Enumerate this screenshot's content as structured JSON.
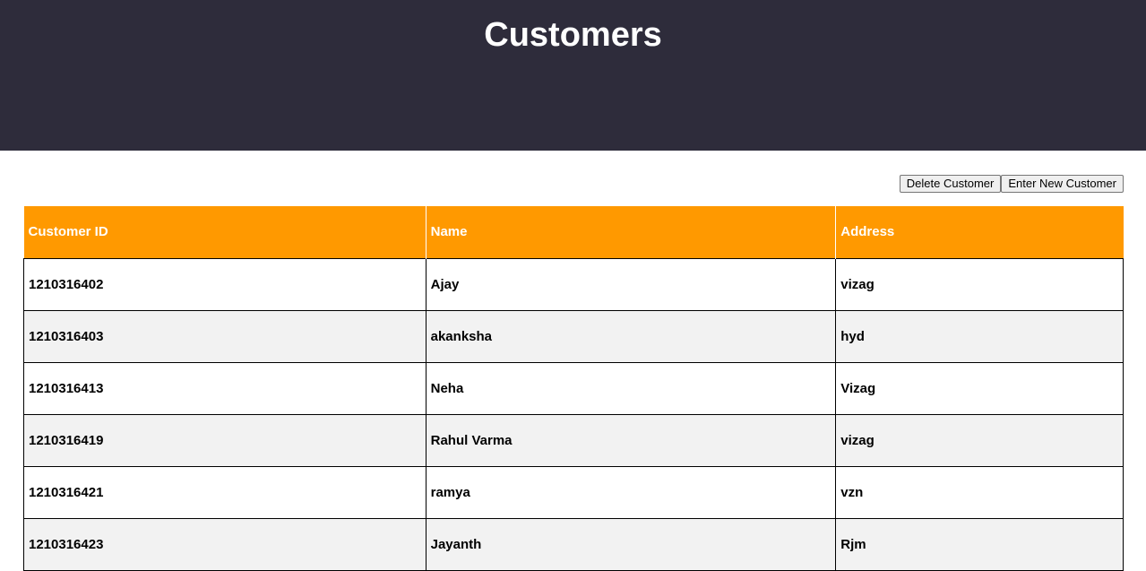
{
  "header": {
    "title": "Customers",
    "background": "#2e2c3b"
  },
  "toolbar": {
    "delete_label": "Delete Customer",
    "new_label": "Enter New Customer"
  },
  "table": {
    "header_color": "#ff9900",
    "columns": [
      "Customer ID",
      "Name",
      "Address"
    ],
    "rows": [
      [
        "1210316402",
        "Ajay",
        "vizag"
      ],
      [
        "1210316403",
        "akanksha",
        "hyd"
      ],
      [
        "1210316413",
        "Neha",
        "Vizag"
      ],
      [
        "1210316419",
        "Rahul Varma",
        "vizag"
      ],
      [
        "1210316421",
        "ramya",
        "vzn"
      ],
      [
        "1210316423",
        "Jayanth",
        "Rjm"
      ]
    ]
  }
}
